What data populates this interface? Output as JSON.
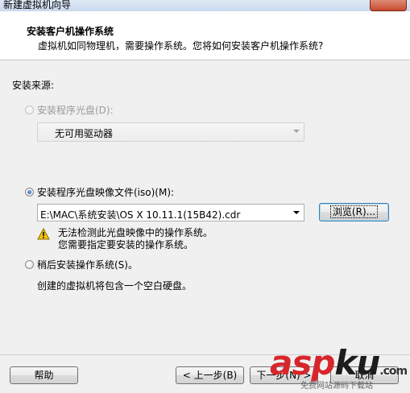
{
  "window": {
    "title": "新建虚拟机向导"
  },
  "header": {
    "title": "安装客户机操作系统",
    "subtitle": "虚拟机如同物理机，需要操作系统。您将如何安装客户机操作系统?"
  },
  "install_source_label": "安装来源:",
  "options": {
    "disc": {
      "label": "安装程序光盘(D):",
      "selected": false,
      "enabled": false,
      "drive_value": "无可用驱动器"
    },
    "iso": {
      "label": "安装程序光盘映像文件(iso)(M):",
      "selected": true,
      "enabled": true,
      "path_value": "E:\\MAC\\系统安装\\OS X 10.11.1(15B42).cdr",
      "browse_label": "浏览(R)...",
      "warning_line1": "无法检测此光盘映像中的操作系统。",
      "warning_line2": "您需要指定要安装的操作系统。"
    },
    "later": {
      "label": "稍后安装操作系统(S)。",
      "selected": false,
      "enabled": true,
      "description": "创建的虚拟机将包含一个空白硬盘。"
    }
  },
  "footer": {
    "help_label": "帮助",
    "back_label": "< 上一步(B)",
    "next_label": "下一步(N) >",
    "cancel_label": "取消"
  },
  "watermark": {
    "text_red": "asp",
    "text_dark": "ku",
    "tagline": "免费网站源码下载站",
    "domain": ".com"
  },
  "colors": {
    "accent_radio": "#1c4f9c",
    "warning_yellow": "#f5c400",
    "watermark_red": "#d7262b"
  }
}
